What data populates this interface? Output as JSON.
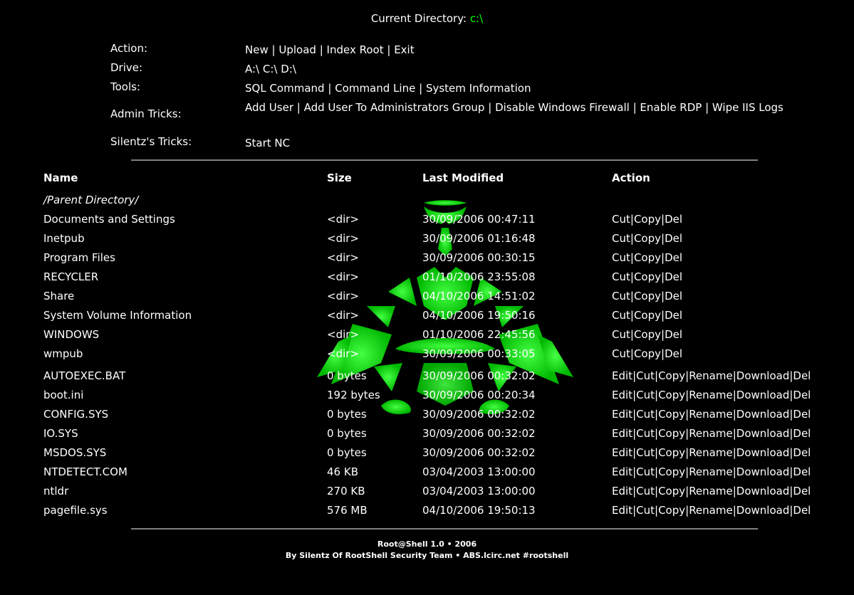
{
  "header": {
    "current_directory_label": "Current Directory:",
    "current_directory_path": "c:\\"
  },
  "menu": {
    "action": {
      "label": "Action:",
      "links": [
        "New",
        "Upload",
        "Index Root",
        "Exit"
      ]
    },
    "drive": {
      "label": "Drive:",
      "links": [
        "A:\\",
        "C:\\",
        "D:\\"
      ]
    },
    "tools": {
      "label": "Tools:",
      "links": [
        "SQL Command",
        "Command Line",
        "System Information"
      ]
    },
    "admin_tricks": {
      "label": "Admin Tricks:",
      "links": [
        "Add User",
        "Add User To Administrators Group",
        "Disable Windows Firewall",
        "Enable RDP",
        "Wipe IIS Logs"
      ]
    },
    "silentz_tricks": {
      "label": "Silentz's Tricks:",
      "links": [
        "Start NC"
      ]
    }
  },
  "table": {
    "headers": {
      "name": "Name",
      "size": "Size",
      "last_modified": "Last Modified",
      "action": "Action"
    },
    "parent_directory": "/Parent Directory/",
    "directory_actions": [
      "Cut",
      "Copy",
      "Del"
    ],
    "file_actions": [
      "Edit",
      "Cut",
      "Copy",
      "Rename",
      "Download",
      "Del"
    ],
    "directories": [
      {
        "name": "Documents and Settings",
        "size": "<dir>",
        "modified": "30/09/2006 00:47:11"
      },
      {
        "name": "Inetpub",
        "size": "<dir>",
        "modified": "30/09/2006 01:16:48"
      },
      {
        "name": "Program Files",
        "size": "<dir>",
        "modified": "30/09/2006 00:30:15"
      },
      {
        "name": "RECYCLER",
        "size": "<dir>",
        "modified": "01/10/2006 23:55:08"
      },
      {
        "name": "Share",
        "size": "<dir>",
        "modified": "04/10/2006 14:51:02"
      },
      {
        "name": "System Volume Information",
        "size": "<dir>",
        "modified": "04/10/2006 19:50:16"
      },
      {
        "name": "WINDOWS",
        "size": "<dir>",
        "modified": "01/10/2006 22:45:56"
      },
      {
        "name": "wmpub",
        "size": "<dir>",
        "modified": "30/09/2006 00:33:05"
      }
    ],
    "files": [
      {
        "name": "AUTOEXEC.BAT",
        "size": "0 bytes",
        "modified": "30/09/2006 00:32:02"
      },
      {
        "name": "boot.ini",
        "size": "192 bytes",
        "modified": "30/09/2006 00:20:34"
      },
      {
        "name": "CONFIG.SYS",
        "size": "0 bytes",
        "modified": "30/09/2006 00:32:02"
      },
      {
        "name": "IO.SYS",
        "size": "0 bytes",
        "modified": "30/09/2006 00:32:02"
      },
      {
        "name": "MSDOS.SYS",
        "size": "0 bytes",
        "modified": "30/09/2006 00:32:02"
      },
      {
        "name": "NTDETECT.COM",
        "size": "46 KB",
        "modified": "03/04/2003 13:00:00"
      },
      {
        "name": "ntldr",
        "size": "270 KB",
        "modified": "03/04/2003 13:00:00"
      },
      {
        "name": "pagefile.sys",
        "size": "576 MB",
        "modified": "04/10/2006 19:50:13"
      }
    ]
  },
  "footer": {
    "line1": "Root@Shell 1.0 • 2006",
    "line2": "By Silentz Of RootShell Security Team • ABS.lcirc.net #rootshell"
  },
  "colors": {
    "background": "#000000",
    "text": "#ffffff",
    "accent": "#00ff00",
    "rule": "#808080"
  },
  "icons": {
    "background_logo": "green-tribal-scorpion-logo"
  }
}
